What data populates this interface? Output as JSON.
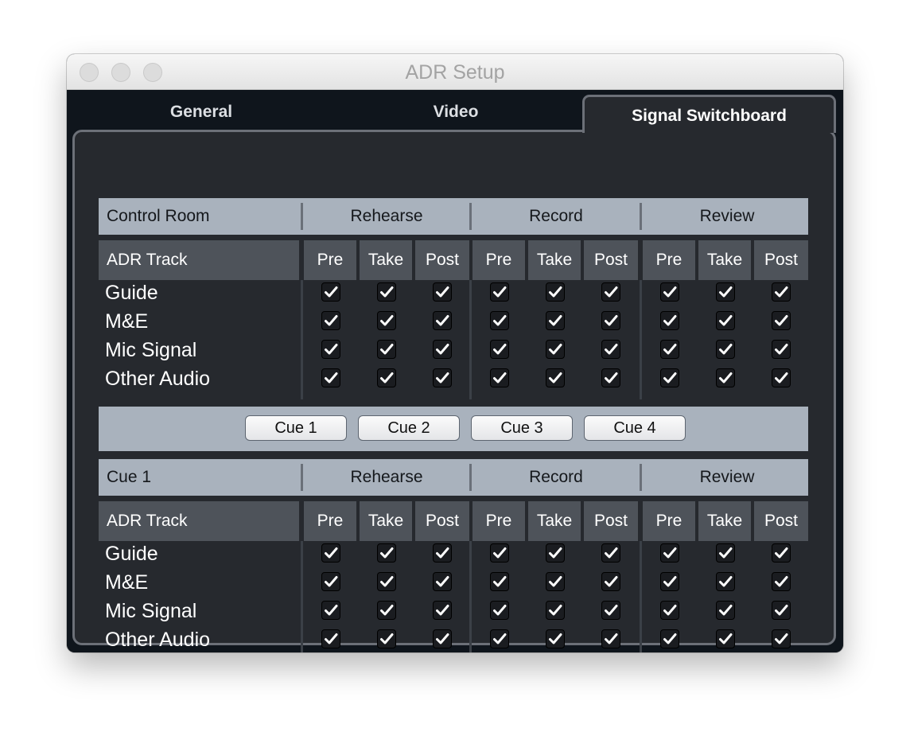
{
  "window": {
    "title": "ADR Setup"
  },
  "tabs": [
    {
      "label": "General",
      "active": false
    },
    {
      "label": "Video",
      "active": false
    },
    {
      "label": "Signal Switchboard",
      "active": true
    }
  ],
  "column_groups": [
    "Rehearse",
    "Record",
    "Review"
  ],
  "sub_columns": [
    "Pre",
    "Take",
    "Post"
  ],
  "sections": [
    {
      "header_label": "Control Room",
      "sub_header_label": "ADR Track",
      "rows": [
        {
          "label": "Guide",
          "checks": [
            true,
            true,
            true,
            true,
            true,
            true,
            true,
            true,
            true
          ]
        },
        {
          "label": "M&E",
          "checks": [
            true,
            true,
            true,
            true,
            true,
            true,
            true,
            true,
            true
          ]
        },
        {
          "label": "Mic Signal",
          "checks": [
            true,
            true,
            true,
            true,
            true,
            true,
            true,
            true,
            true
          ]
        },
        {
          "label": "Other Audio",
          "checks": [
            true,
            true,
            true,
            true,
            true,
            true,
            true,
            true,
            true
          ]
        }
      ]
    },
    {
      "header_label": "Cue 1",
      "sub_header_label": "ADR Track",
      "rows": [
        {
          "label": "Guide",
          "checks": [
            true,
            true,
            true,
            true,
            true,
            true,
            true,
            true,
            true
          ]
        },
        {
          "label": "M&E",
          "checks": [
            true,
            true,
            true,
            true,
            true,
            true,
            true,
            true,
            true
          ]
        },
        {
          "label": "Mic Signal",
          "checks": [
            true,
            true,
            true,
            true,
            true,
            true,
            true,
            true,
            true
          ]
        },
        {
          "label": "Other Audio",
          "checks": [
            true,
            true,
            true,
            true,
            true,
            true,
            true,
            true,
            true
          ]
        }
      ]
    }
  ],
  "cue_buttons": [
    "Cue 1",
    "Cue 2",
    "Cue 3",
    "Cue 4"
  ],
  "colors": {
    "background": "#0f151c",
    "panel": "#26292e",
    "header": "#a9b2bd",
    "subheader": "#4e535a",
    "check": "#ffffff"
  },
  "icons": {
    "checkbox": "checkmark-icon"
  }
}
